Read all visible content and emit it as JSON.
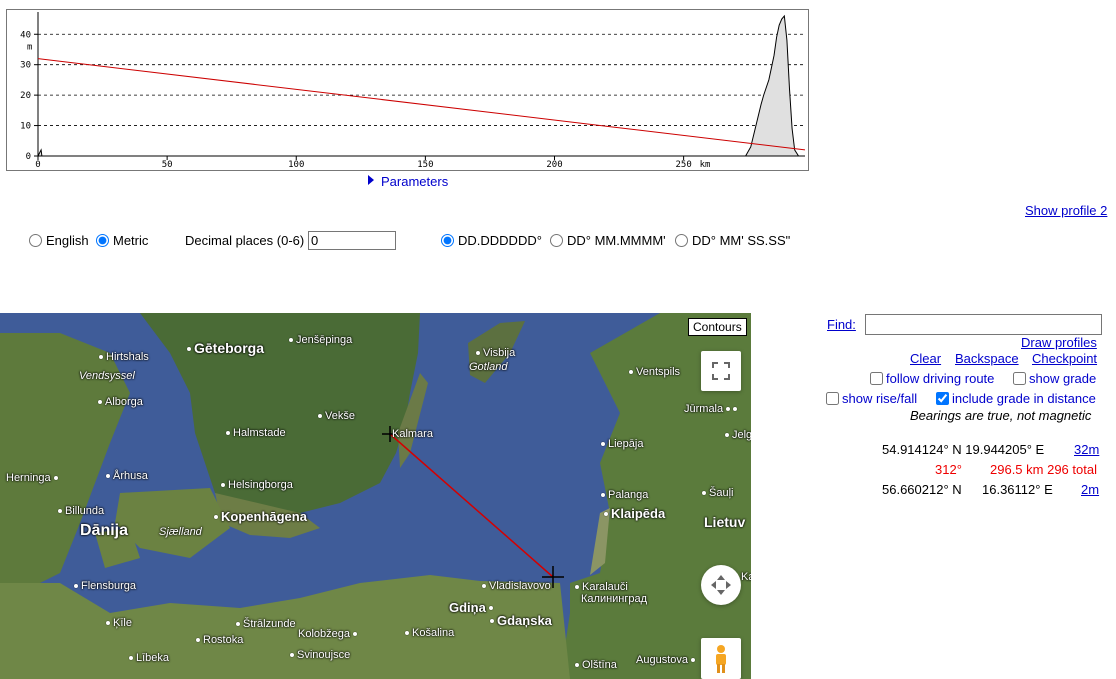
{
  "chart_data": {
    "type": "area",
    "ylabel": "m",
    "xlabel": "km",
    "y_ticks": [
      "0",
      "10",
      "20",
      "30",
      "40"
    ],
    "x_ticks": [
      "0",
      "50",
      "100",
      "150",
      "200",
      "250"
    ],
    "xlim": [
      0,
      297
    ],
    "ylim": [
      0,
      46
    ],
    "grid": "dashed horizontal",
    "series": [
      {
        "type": "area",
        "x": [
          0,
          1.2,
          1.5,
          274,
          276,
          278,
          280,
          281,
          283,
          284,
          285,
          286,
          287,
          288,
          289,
          290,
          291,
          292,
          293,
          294.5,
          297
        ],
        "y": [
          0,
          2,
          0,
          0,
          3,
          10,
          17,
          20,
          25,
          29,
          33,
          39,
          43,
          45,
          46,
          38,
          22,
          9,
          2,
          0,
          0
        ]
      },
      {
        "type": "line",
        "color": "#cc0000",
        "x": [
          0,
          297
        ],
        "y": [
          32,
          2
        ]
      }
    ]
  },
  "parameters_label": "Parameters",
  "show_profile2": "Show profile 2",
  "units": {
    "english": "English",
    "metric": "Metric",
    "selected": "Metric"
  },
  "decimals": {
    "label": "Decimal places (0-6)",
    "value": "0"
  },
  "formats": {
    "dd": "DD.DDDDDD°",
    "dm": "DD° MM.MMMM'",
    "dms": "DD° MM' SS.SS\"",
    "selected": "DD.DDDDDD°"
  },
  "map": {
    "contours": "Contours",
    "labels": {
      "geteborga": "Gēteborga",
      "jensepinga": "Jenšēpinga",
      "hirtshals": "Hirtshals",
      "vendsyssel": "Vendsyssel",
      "alborga": "Alborga",
      "visbija": "Visbija",
      "gotland": "Gotland",
      "ventspils": "Ventspils",
      "vekse": "Vekše",
      "halmstade": "Halmstade",
      "kalmara": "Kalmara",
      "jurmala": "Jūrmala",
      "jelg": "Jelg",
      "liepaja": "Liepāja",
      "herninga": "Herninga",
      "arhusa": "Århusa",
      "helsingborga": "Helsingborga",
      "palanga": "Palanga",
      "sauli": "Šauļi",
      "billunda": "Billunda",
      "kopenhagena": "Kopenhāgena",
      "klaipeda": "Klaipēda",
      "lietuv": "Lietuv",
      "danija": "Dānija",
      "sjaelland": "Sjælland",
      "flensburga": "Flensburga",
      "vladislavovo": "Vladislavovo",
      "karalauci": "Karalauči",
      "kaliningrad": "Калининград",
      "ka": "Ka",
      "gdina": "Gdiņa",
      "gdanska": "Gdaņska",
      "kile": "Ķīle",
      "stralzunde": "Štrālzunde",
      "rostoka": "Rostoka",
      "kolobzega": "Kolobžega",
      "kosalina": "Košalina",
      "libeka": "Lībeka",
      "svinoujsce": "Svinoujsce",
      "olstina": "Olštīna",
      "augustova": "Augustova"
    }
  },
  "panel": {
    "find_label": "Find:",
    "find_value": "",
    "draw_profiles": "Draw profiles",
    "clear": "Clear",
    "backspace": "Backspace",
    "checkpoint": "Checkpoint",
    "follow_driving": "follow driving route",
    "show_grade": "show grade",
    "show_rise_fall": "show rise/fall",
    "include_grade": "include grade in distance",
    "bearings_note": "Bearings are true, not magnetic",
    "point1": {
      "coords": "54.914124° N 19.944205° E",
      "elev": "32m"
    },
    "segment": {
      "bearing": "312°",
      "distance": "296.5 km 296 total"
    },
    "point2": {
      "coords": "56.660212° N",
      "lon": "16.36112° E",
      "elev": "2m"
    }
  }
}
